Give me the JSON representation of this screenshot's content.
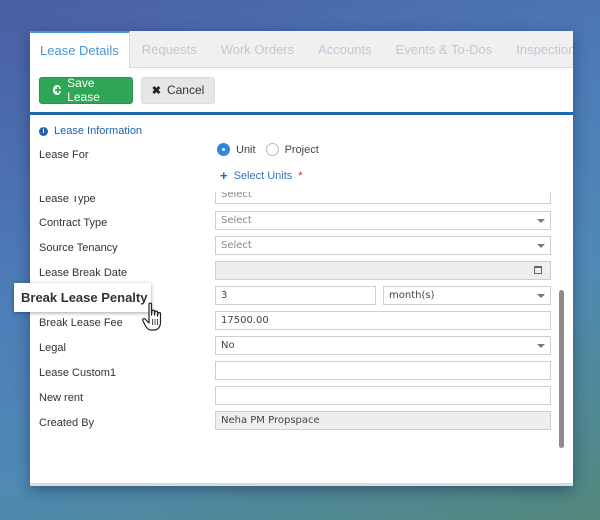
{
  "tabs": [
    {
      "label": "Lease Details",
      "active": true
    },
    {
      "label": "Requests",
      "active": false
    },
    {
      "label": "Work Orders",
      "active": false
    },
    {
      "label": "Accounts",
      "active": false
    },
    {
      "label": "Events & To-Dos",
      "active": false
    },
    {
      "label": "Inspections",
      "active": false
    }
  ],
  "toolbar": {
    "save_label": "Save Lease",
    "cancel_label": "Cancel"
  },
  "section": {
    "title": "Lease Information",
    "icon": "info-icon"
  },
  "lease_for": {
    "label": "Lease For",
    "options": [
      "Unit",
      "Project"
    ],
    "selected": "Unit",
    "select_units_label": "Select Units",
    "required_mark": "*"
  },
  "fields": {
    "lease_type": {
      "label": "Lease Type",
      "value": "Select"
    },
    "contract_type": {
      "label": "Contract Type",
      "value": "Select"
    },
    "source_tenancy": {
      "label": "Source Tenancy",
      "value": "Select"
    },
    "lease_break_date": {
      "label": "Lease Break Date",
      "value": ""
    },
    "break_lease_penalty": {
      "label": "Break Lease Penalty",
      "value": "3",
      "unit": "month(s)"
    },
    "break_lease_fee": {
      "label": "Break Lease Fee",
      "value": "17500.00"
    },
    "legal": {
      "label": "Legal",
      "value": "No"
    },
    "lease_custom1": {
      "label": "Lease Custom1",
      "value": ""
    },
    "new_rent": {
      "label": "New rent",
      "value": ""
    },
    "created_by": {
      "label": "Created By",
      "value": "Neha PM Propspace"
    }
  },
  "tooltip": {
    "text": "Break Lease Penalty"
  },
  "colors": {
    "accent": "#4a95d8",
    "save_button": "#2fa655",
    "header_rule": "#1d6aa9",
    "section_title": "#2363a8",
    "required": "#d9232d"
  }
}
